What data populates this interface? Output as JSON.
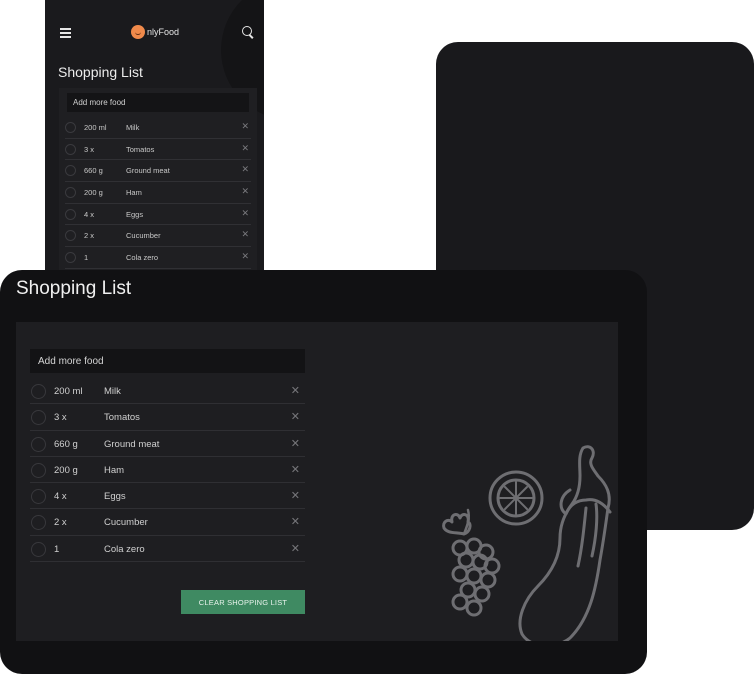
{
  "phone": {
    "brand_text": "nlyFood",
    "title": "Shopping List",
    "add_placeholder": "Add more food",
    "items": [
      {
        "qty": "200 ml",
        "name": "Milk"
      },
      {
        "qty": "3 x",
        "name": "Tomatos"
      },
      {
        "qty": "660 g",
        "name": "Ground meat"
      },
      {
        "qty": "200 g",
        "name": "Ham"
      },
      {
        "qty": "4 x",
        "name": "Eggs"
      },
      {
        "qty": "2 x",
        "name": "Cucumber"
      },
      {
        "qty": "1",
        "name": "Cola zero"
      }
    ]
  },
  "tablet": {
    "title": "Shopping List",
    "add_placeholder": "Add more food",
    "items": [
      {
        "qty": "200 ml",
        "name": "Milk"
      },
      {
        "qty": "3 x",
        "name": "Tomatos"
      },
      {
        "qty": "660 g",
        "name": "Ground meat"
      },
      {
        "qty": "200 g",
        "name": "Ham"
      },
      {
        "qty": "4 x",
        "name": "Eggs"
      },
      {
        "qty": "2 x",
        "name": "Cucumber"
      },
      {
        "qty": "1",
        "name": "Cola zero"
      }
    ],
    "clear_label": "CLEAR SHOPPING LIST"
  },
  "icons": {
    "menu": "hamburger-icon",
    "search": "search-icon",
    "remove": "close-icon",
    "check": "circle-checkbox-icon"
  },
  "colors": {
    "accent": "#3f8a62",
    "background_dark": "#111113",
    "panel": "#1e1e21",
    "brand_orange": "#f08a4b"
  }
}
